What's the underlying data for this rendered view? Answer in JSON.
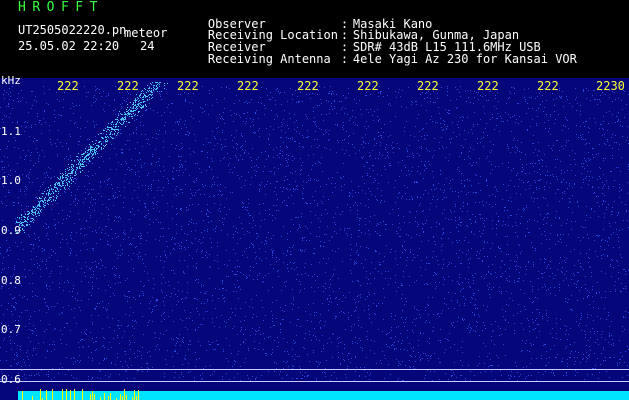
{
  "header": {
    "app_title": "HROFFT",
    "file_name": "UT2505022220.pn",
    "event_label": "meteor",
    "datetime": "25.05.02 22:20",
    "count": "24"
  },
  "info": [
    {
      "key": "Observer",
      "value": "Masaki Kano"
    },
    {
      "key": "Receiving Location",
      "value": "Shibukawa, Gunma, Japan"
    },
    {
      "key": "Receiver",
      "value": "SDR# 43dB L15 111.6MHz USB"
    },
    {
      "key": "Receiving Antenna",
      "value": "4ele Yagi Az 230 for Kansai VOR"
    }
  ],
  "spectrogram": {
    "unit": "kHz",
    "y_ticks": [
      "1.1",
      "1.0",
      "0.9",
      "0.8",
      "0.7",
      "0.6"
    ],
    "x_ticks": [
      "222",
      "222",
      "222",
      "222",
      "222",
      "222",
      "222",
      "222",
      "222"
    ],
    "x_end_tick": "2230",
    "colors": {
      "background": "#05067a",
      "noise": "#3b5cff",
      "trail": "#5ad8ff",
      "signal": "#ffff00",
      "baseline": "#00e5ff",
      "guide": "#c9c9ff"
    }
  }
}
